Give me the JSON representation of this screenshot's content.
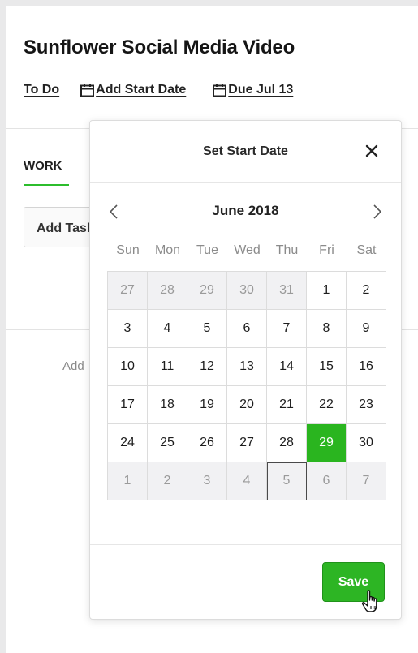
{
  "task": {
    "title": "Sunflower Social Media Video",
    "status_link": "To Do",
    "start_date_link": "Add Start Date",
    "due_link": "Due Jul 13",
    "tab_work": "WORK",
    "add_task_button": "Add Task",
    "add_hint": "Add"
  },
  "date_picker": {
    "title": "Set Start Date",
    "month_label": "June 2018",
    "weekdays": [
      "Sun",
      "Mon",
      "Tue",
      "Wed",
      "Thu",
      "Fri",
      "Sat"
    ],
    "weeks": [
      [
        "27",
        "28",
        "29",
        "30",
        "31",
        "1",
        "2"
      ],
      [
        "3",
        "4",
        "5",
        "6",
        "7",
        "8",
        "9"
      ],
      [
        "10",
        "11",
        "12",
        "13",
        "14",
        "15",
        "16"
      ],
      [
        "17",
        "18",
        "19",
        "20",
        "21",
        "22",
        "23"
      ],
      [
        "24",
        "25",
        "26",
        "27",
        "28",
        "29",
        "30"
      ],
      [
        "1",
        "2",
        "3",
        "4",
        "5",
        "6",
        "7"
      ]
    ],
    "selected_day": "29",
    "today_outline_day": "5",
    "save_button": "Save"
  },
  "icons": {
    "calendar": "calendar-icon",
    "close": "close-icon",
    "prev": "chevron-left-icon",
    "next": "chevron-right-icon",
    "cursor": "hand-cursor-icon"
  },
  "colors": {
    "accent_green": "#2db524",
    "muted_cell": "#f1f1f3"
  }
}
